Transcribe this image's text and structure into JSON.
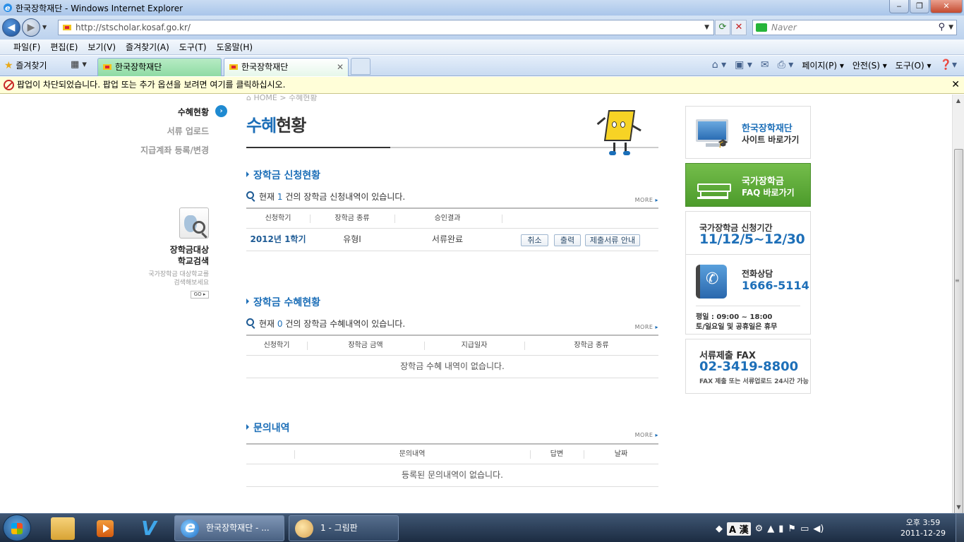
{
  "window": {
    "title": "한국장학재단 - Windows Internet Explorer",
    "controls": {
      "minimize": "‒",
      "maximize": "❐",
      "close": "✕"
    }
  },
  "address": {
    "url": "http://stscholar.kosaf.go.kr/",
    "search_placeholder": "Naver"
  },
  "menu": [
    "파일(F)",
    "편집(E)",
    "보기(V)",
    "즐겨찾기(A)",
    "도구(T)",
    "도움말(H)"
  ],
  "favorites_label": "즐겨찾기",
  "tabs": [
    {
      "label": "한국장학재단"
    },
    {
      "label": "한국장학재단"
    }
  ],
  "command_bar": {
    "page": "페이지(P)",
    "safety": "안전(S)",
    "tools": "도구(O)"
  },
  "infobar": {
    "message": "팝업이 차단되었습니다. 팝업 또는 추가 옵션을 보려면 여기를 클릭하십시오."
  },
  "left_nav": {
    "items": [
      "수혜현황",
      "서류 업로드",
      "지급계좌 등록/변경"
    ],
    "school_search": {
      "title_line1": "장학금대상",
      "title_line2": "학교검색",
      "desc_line1": "국가장학금 대상학교를",
      "desc_line2": "검색해보세요",
      "go": "GO"
    }
  },
  "main": {
    "breadcrumb": "HOME > 수혜현황",
    "title_accent": "수혜",
    "title_rest": "현황",
    "more": "MORE",
    "application": {
      "heading": "장학금 신청현황",
      "count_prefix": "현재",
      "count": "1",
      "count_suffix": "건의 장학금 신청내역이 있습니다.",
      "headers": [
        "신청학기",
        "장학금 종류",
        "승인결과"
      ],
      "rows": [
        {
          "term": "2012년 1학기",
          "type": "유형Ⅰ",
          "result": "서류완료"
        }
      ],
      "buttons": {
        "cancel": "취소",
        "print": "출력",
        "docs": "제출서류 안내"
      }
    },
    "benefit": {
      "heading": "장학금 수혜현황",
      "count_prefix": "현재",
      "count": "0",
      "count_suffix": "건의 장학금 수혜내역이 있습니다.",
      "headers": [
        "신청학기",
        "장학금 금액",
        "지급일자",
        "장학금 종류"
      ],
      "empty": "장학금 수혜 내역이 없습니다."
    },
    "inquiry": {
      "heading": "문의내역",
      "headers": [
        "문의내역",
        "답변",
        "날짜"
      ],
      "empty": "등록된 문의내역이 없습니다."
    }
  },
  "banners": {
    "site": {
      "line1": "한국장학재단",
      "line2": "사이트 바로가기"
    },
    "faq": {
      "line1": "국가장학금",
      "line2": "FAQ 바로가기"
    },
    "period": {
      "line1": "국가장학금 신청기간",
      "line2": "11/12/5~12/30"
    },
    "phone": {
      "line1": "전화상담",
      "line2": "1666-5114",
      "hours1": "평일 : 09:00 ~ 18:00",
      "hours2": "토/일요일 및 공휴일은 휴무"
    },
    "fax": {
      "line1": "서류제출 FAX",
      "line2": "02-3419-8800",
      "note": "FAX 제출 또는 서류업로드 24시간 가능"
    }
  },
  "taskbar": {
    "tasks": [
      {
        "label": "한국장학재단 - ..."
      },
      {
        "label": "1 - 그림판"
      }
    ],
    "ime": "A 漢",
    "clock_time": "오후 3:59",
    "clock_date": "2011-12-29"
  },
  "colors": {
    "accent_blue": "#1d6fb8",
    "faq_green": "#5aab37",
    "infobar_yellow": "#fffed8"
  }
}
